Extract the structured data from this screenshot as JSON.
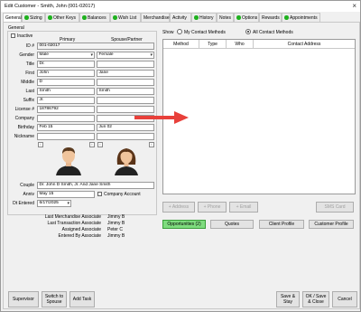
{
  "window": {
    "title": "Edit Customer - Smith, John (001-02017)"
  },
  "tabs": [
    {
      "label": "General",
      "dot": false,
      "active": true
    },
    {
      "label": "Sizing",
      "dot": true
    },
    {
      "label": "Other Keys",
      "dot": true
    },
    {
      "label": "Balances",
      "dot": true
    },
    {
      "label": "Wish List",
      "dot": true
    },
    {
      "label": "Merchandise",
      "dot": false
    },
    {
      "label": "Activity",
      "dot": false
    },
    {
      "label": "History",
      "dot": true
    },
    {
      "label": "Notes",
      "dot": false
    },
    {
      "label": "Options",
      "dot": true
    },
    {
      "label": "Rewards",
      "dot": false
    },
    {
      "label": "Appointments",
      "dot": true
    }
  ],
  "general": {
    "section_label": "General",
    "inactive_label": "Inactive",
    "primary_header": "Primary",
    "spouse_header": "Spouse/Partner",
    "id_label": "ID #",
    "id_value": "001-02017",
    "gender_label": "Gender",
    "gender_primary": "Male",
    "gender_spouse": "Female",
    "title_label": "Title",
    "title_primary": "Dr.",
    "title_spouse": "",
    "first_label": "First",
    "first_primary": "John",
    "first_spouse": "Jane",
    "middle_label": "Middle",
    "middle_primary": "D",
    "middle_spouse": "",
    "last_label": "Last",
    "last_primary": "Smith",
    "last_spouse": "Smith",
    "suffix_label": "Suffix",
    "suffix_primary": "Jr.",
    "suffix_spouse": "",
    "license_label": "License #",
    "license_primary": "18786792",
    "license_spouse": "",
    "company_label": "Company",
    "birthday_label": "Birthday",
    "birthday_primary": "Feb 15",
    "birthday_spouse": "Jun 02",
    "nickname_label": "Nickname",
    "couple_label": "Couple",
    "couple_value": "Dr. John D Smith, Jr. And Jane Smith",
    "anniv_label": "Anniv",
    "anniv_value": "May 15",
    "company_account_label": "Company Account",
    "dt_entered_label": "Dt Entered",
    "dt_entered_value": "6/17/2025",
    "associates": [
      {
        "label": "Last Merchandise Associate",
        "value": "Jimmy B"
      },
      {
        "label": "Last Transaction Associate",
        "value": "Jimmy B"
      },
      {
        "label": "Assigned Associate",
        "value": "Peter C"
      },
      {
        "label": "Entered By Associate",
        "value": "Jimmy B"
      }
    ]
  },
  "contact": {
    "show_label": "Show",
    "my_methods": "My Contact Methods",
    "all_methods": "All Contact Methods",
    "columns": [
      "Method",
      "Type",
      "Who",
      "Contact Address"
    ],
    "add_address": "+ Address",
    "add_phone": "+ Phone",
    "add_email": "+ Email",
    "sms_card": "SMS Card",
    "opportunities": "Opportunities (2)",
    "quotes": "Quotes",
    "client_profile": "Client Profile",
    "customer_profile": "Customer Profile"
  },
  "footer": {
    "supervisor": "Supervisor",
    "switch_spouse_1": "Switch to",
    "switch_spouse_2": "Spouse",
    "add_task": "Add Task",
    "save_stay_1": "Save &",
    "save_stay_2": "Stay",
    "ok_save_close_1": "OK / Save",
    "ok_save_close_2": "& Close",
    "cancel": "Cancel"
  },
  "colors": {
    "tab_dot": "#1fb11f",
    "opportunities_bg": "#7fdc7f",
    "arrow": "#e8403a"
  }
}
